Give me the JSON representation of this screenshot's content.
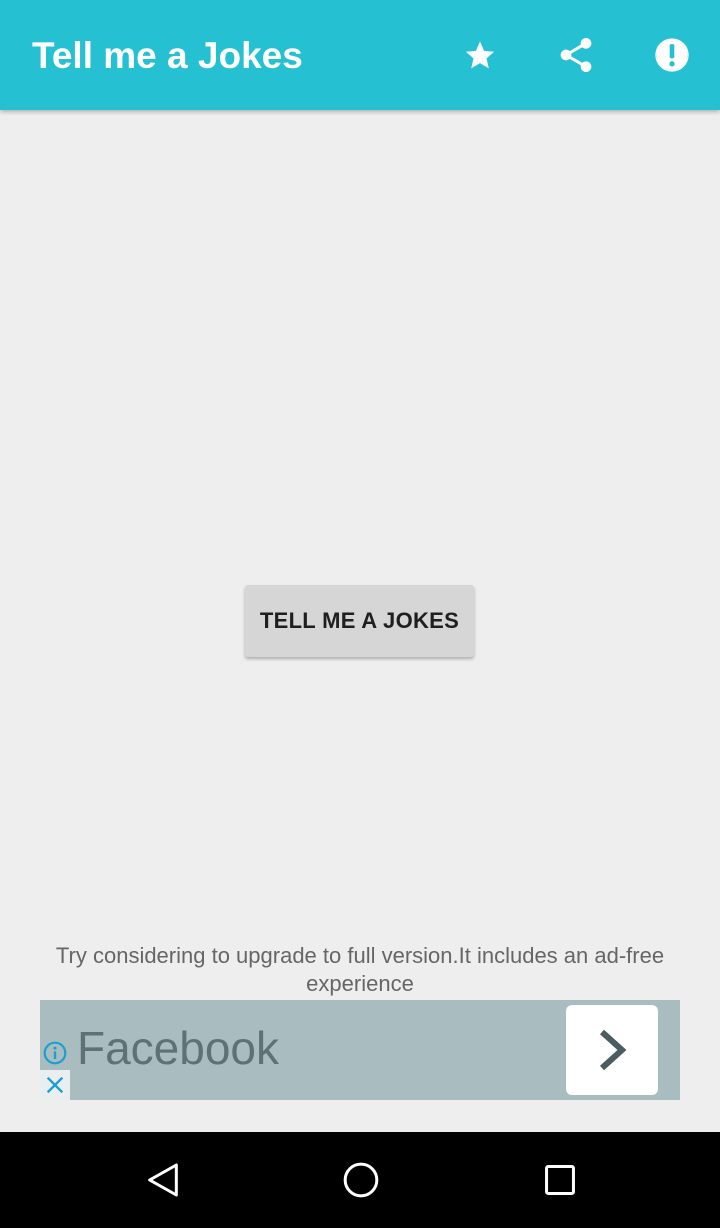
{
  "app_bar": {
    "title": "Tell me a Jokes",
    "background_color": "#26c0d3",
    "actions": [
      {
        "icon": "star-icon"
      },
      {
        "icon": "share-icon"
      },
      {
        "icon": "alert-icon"
      }
    ]
  },
  "main": {
    "button_label": "TELL ME A JOKES"
  },
  "upgrade_notice": {
    "text": "Try considering to upgrade to full version.It includes an ad-free experience"
  },
  "ad": {
    "title": "Facebook",
    "background_color": "#a9bcc0",
    "icons": [
      "info-icon",
      "close-icon",
      "chevron-right-icon"
    ]
  },
  "navigation_bar": {
    "buttons": [
      "back-icon",
      "home-icon",
      "recents-icon"
    ]
  }
}
